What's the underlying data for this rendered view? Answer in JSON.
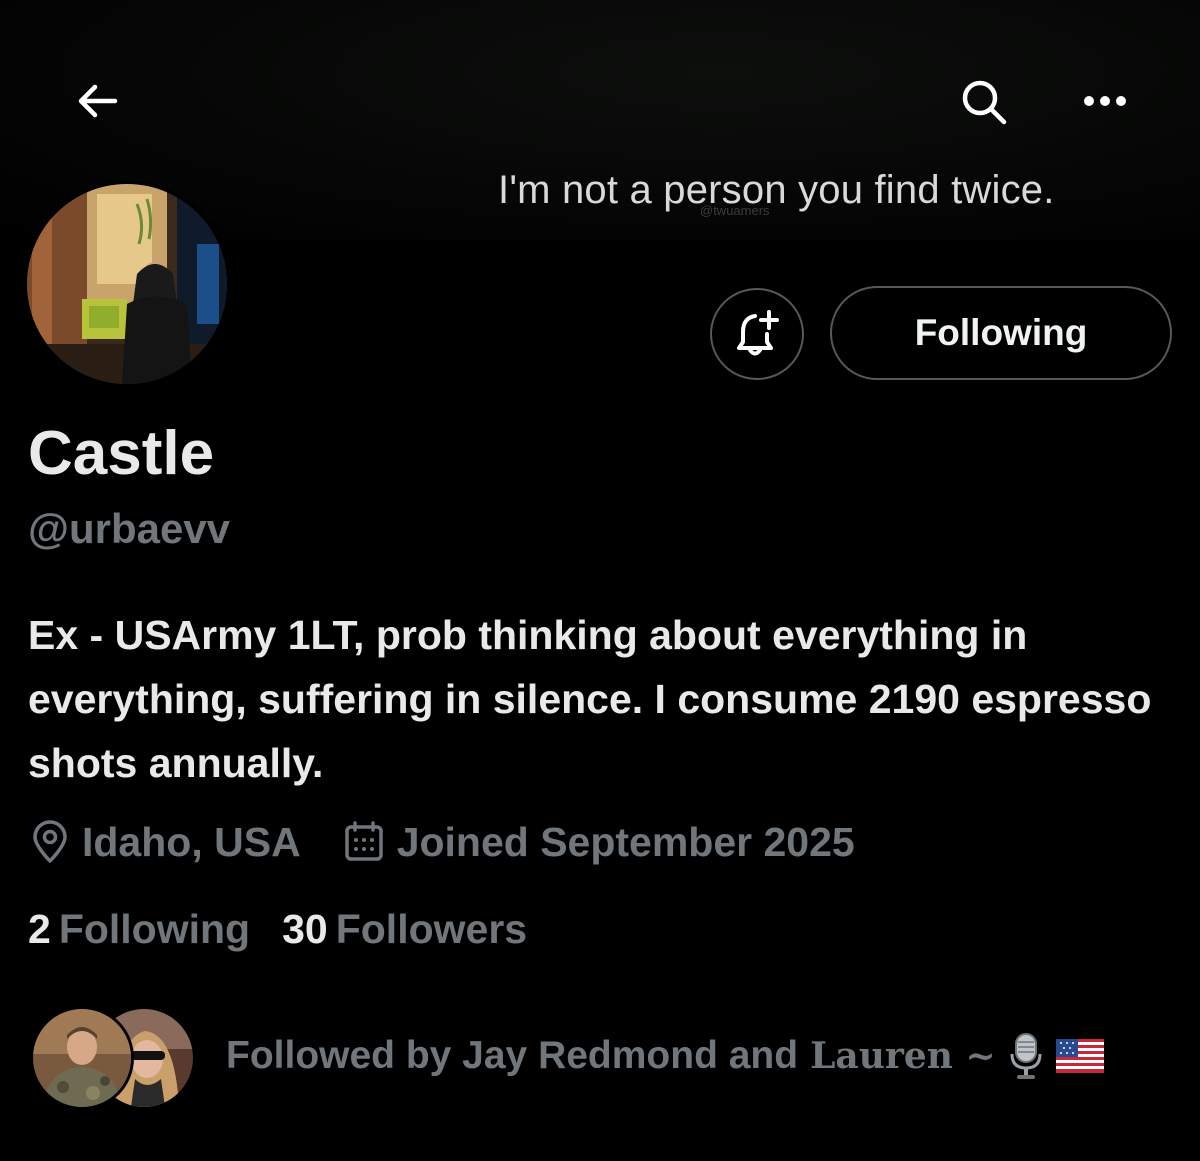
{
  "header": {
    "back_icon": "arrow-left-icon",
    "search_icon": "search-icon",
    "more_icon": "more-horizontal-icon"
  },
  "banner": {
    "text": "I'm not a person you find twice.",
    "watermark": "@twuamers"
  },
  "actions": {
    "notify_icon": "bell-plus-icon",
    "following_label": "Following"
  },
  "profile": {
    "display_name": "Castle",
    "handle": "@urbaevv",
    "bio": "Ex - USArmy 1LT, prob thinking about everything in everything, suffering in silence. I consume 2190 espresso shots annually.",
    "location": "Idaho, USA",
    "joined": "Joined September 2025"
  },
  "stats": {
    "following_count": "2",
    "following_label": "Following",
    "followers_count": "30",
    "followers_label": "Followers"
  },
  "followed_by": {
    "prefix": "Followed by Jay Redmond and",
    "name": "Lauren ~",
    "emojis": [
      "microphone-icon",
      "us-flag-icon"
    ]
  },
  "colors": {
    "background": "#000000",
    "text_primary": "#e7e9ea",
    "text_secondary": "#71767b",
    "border": "#55595d"
  }
}
